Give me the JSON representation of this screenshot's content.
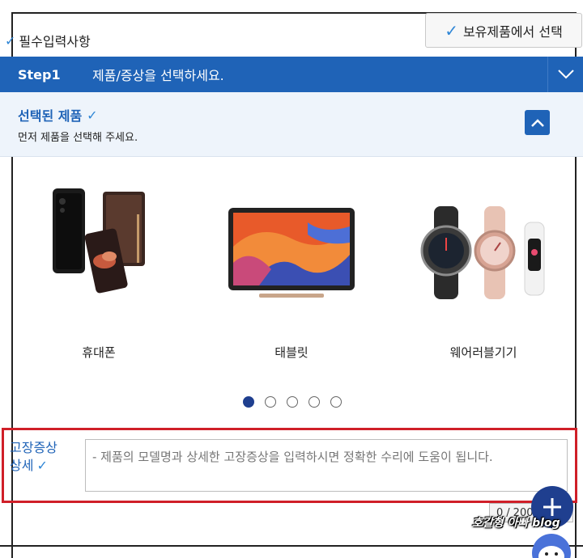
{
  "required_label": "필수입력사항",
  "owned_button_label": "보유제품에서 선택",
  "step": {
    "label": "Step1",
    "title": "제품/증상을 선택하세요."
  },
  "selected": {
    "title": "선택된 제품",
    "description": "먼저 제품을 선택해 주세요."
  },
  "products": [
    {
      "label": "휴대폰",
      "icon": "phone-icon"
    },
    {
      "label": "태블릿",
      "icon": "tablet-icon"
    },
    {
      "label": "웨어러블기기",
      "icon": "smartwatch-icon"
    }
  ],
  "carousel": {
    "total": 5,
    "active_index": 0
  },
  "symptom": {
    "label_line1": "고장증상",
    "label_line2": "상세",
    "placeholder": "- 제품의 모델명과 상세한 고장증상을 입력하시면 정확한 수리에 도움이 됩니다."
  },
  "counter": {
    "current": "0",
    "separator": "/",
    "max": "2000"
  },
  "watermark": "호갈형 아빠 blog",
  "colors": {
    "accent": "#1f63b7",
    "dark_accent": "#1f3f8f",
    "highlight_border": "#d01f28"
  }
}
